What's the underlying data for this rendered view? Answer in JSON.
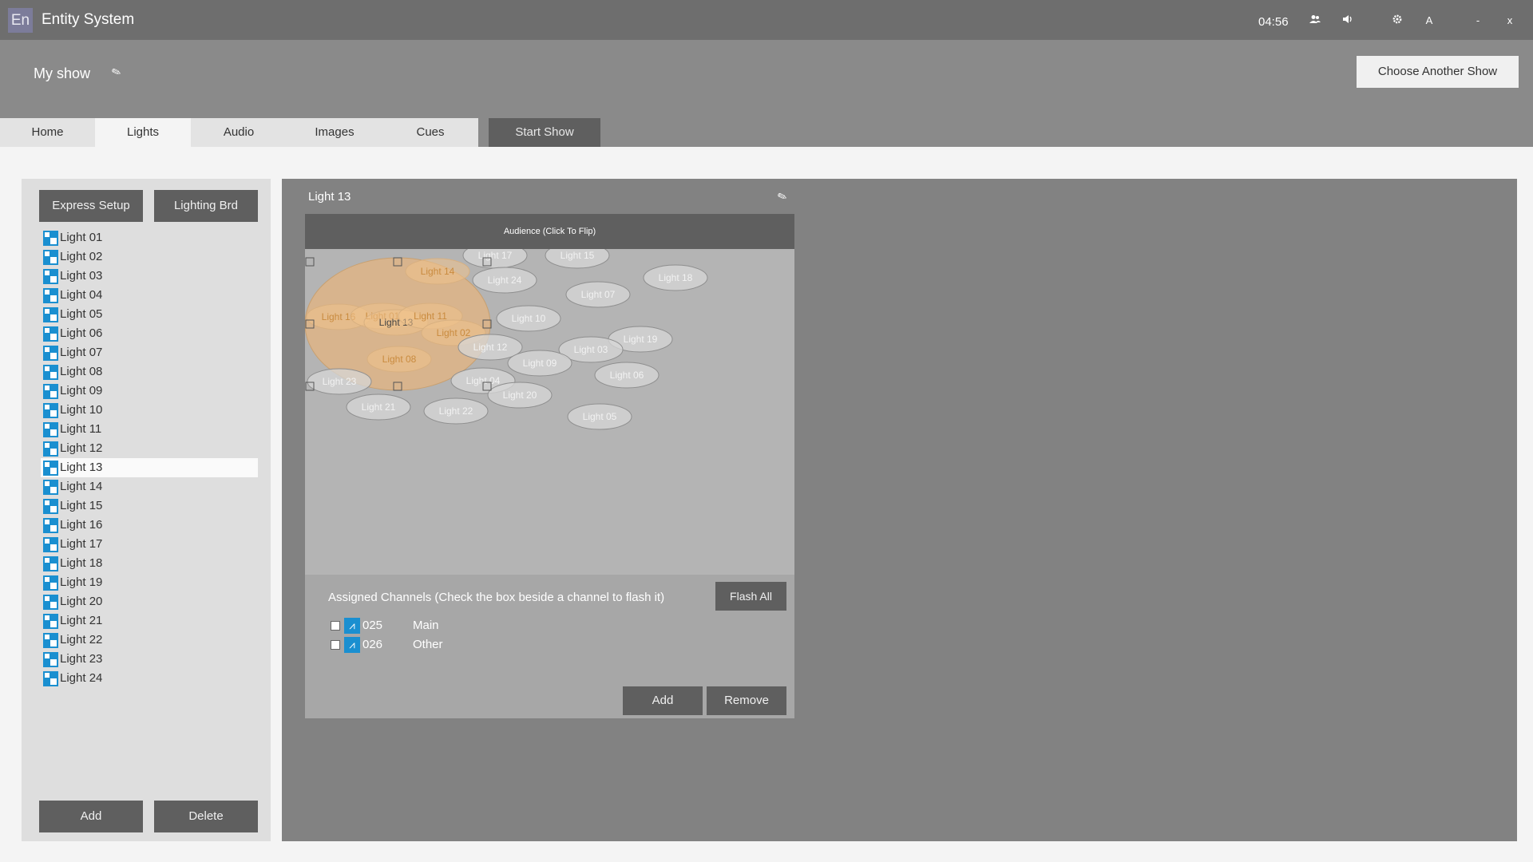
{
  "window": {
    "logo": "En",
    "title": "Entity System",
    "clock": "04:56",
    "icons": {
      "users": "users-icon",
      "volume": "volume-icon",
      "settings": "gear-icon",
      "font": "A",
      "minimize": "-",
      "close": "x"
    }
  },
  "show": {
    "name": "My show",
    "choose_label": "Choose Another Show"
  },
  "tabs": [
    {
      "label": "Home"
    },
    {
      "label": "Lights"
    },
    {
      "label": "Audio"
    },
    {
      "label": "Images"
    },
    {
      "label": "Cues"
    },
    {
      "label": "Start Show"
    }
  ],
  "left": {
    "express_label": "Express Setup",
    "board_label": "Lighting Brd",
    "add_label": "Add",
    "delete_label": "Delete",
    "lights": [
      "Light 01",
      "Light 02",
      "Light 03",
      "Light 04",
      "Light 05",
      "Light 06",
      "Light 07",
      "Light 08",
      "Light 09",
      "Light 10",
      "Light 11",
      "Light 12",
      "Light 13",
      "Light 14",
      "Light 15",
      "Light 16",
      "Light 17",
      "Light 18",
      "Light 19",
      "Light 20",
      "Light 21",
      "Light 22",
      "Light 23",
      "Light 24"
    ],
    "selected": "Light 13"
  },
  "detail": {
    "title": "Light 13",
    "audience_label": "Audience (Click To Flip)",
    "stage_lights": [
      {
        "label": "Light 16"
      },
      {
        "label": "Light 01"
      },
      {
        "label": "Light 13"
      },
      {
        "label": "Light 11"
      },
      {
        "label": "Light 14"
      },
      {
        "label": "Light 17"
      },
      {
        "label": "Light 15"
      },
      {
        "label": "Light 24"
      },
      {
        "label": "Light 18"
      },
      {
        "label": "Light 07"
      },
      {
        "label": "Light 10"
      },
      {
        "label": "Light 02"
      },
      {
        "label": "Light 12"
      },
      {
        "label": "Light 19"
      },
      {
        "label": "Light 03"
      },
      {
        "label": "Light 08"
      },
      {
        "label": "Light 09"
      },
      {
        "label": "Light 06"
      },
      {
        "label": "Light 23"
      },
      {
        "label": "Light 04"
      },
      {
        "label": "Light 20"
      },
      {
        "label": "Light 21"
      },
      {
        "label": "Light 22"
      },
      {
        "label": "Light 05"
      }
    ],
    "channels_title": "Assigned Channels (Check the box beside a channel to flash it)",
    "flash_all_label": "Flash All",
    "channels": [
      {
        "number": "025",
        "name": "Main",
        "checked": false
      },
      {
        "number": "026",
        "name": "Other",
        "checked": false
      }
    ],
    "add_label": "Add",
    "remove_label": "Remove"
  }
}
